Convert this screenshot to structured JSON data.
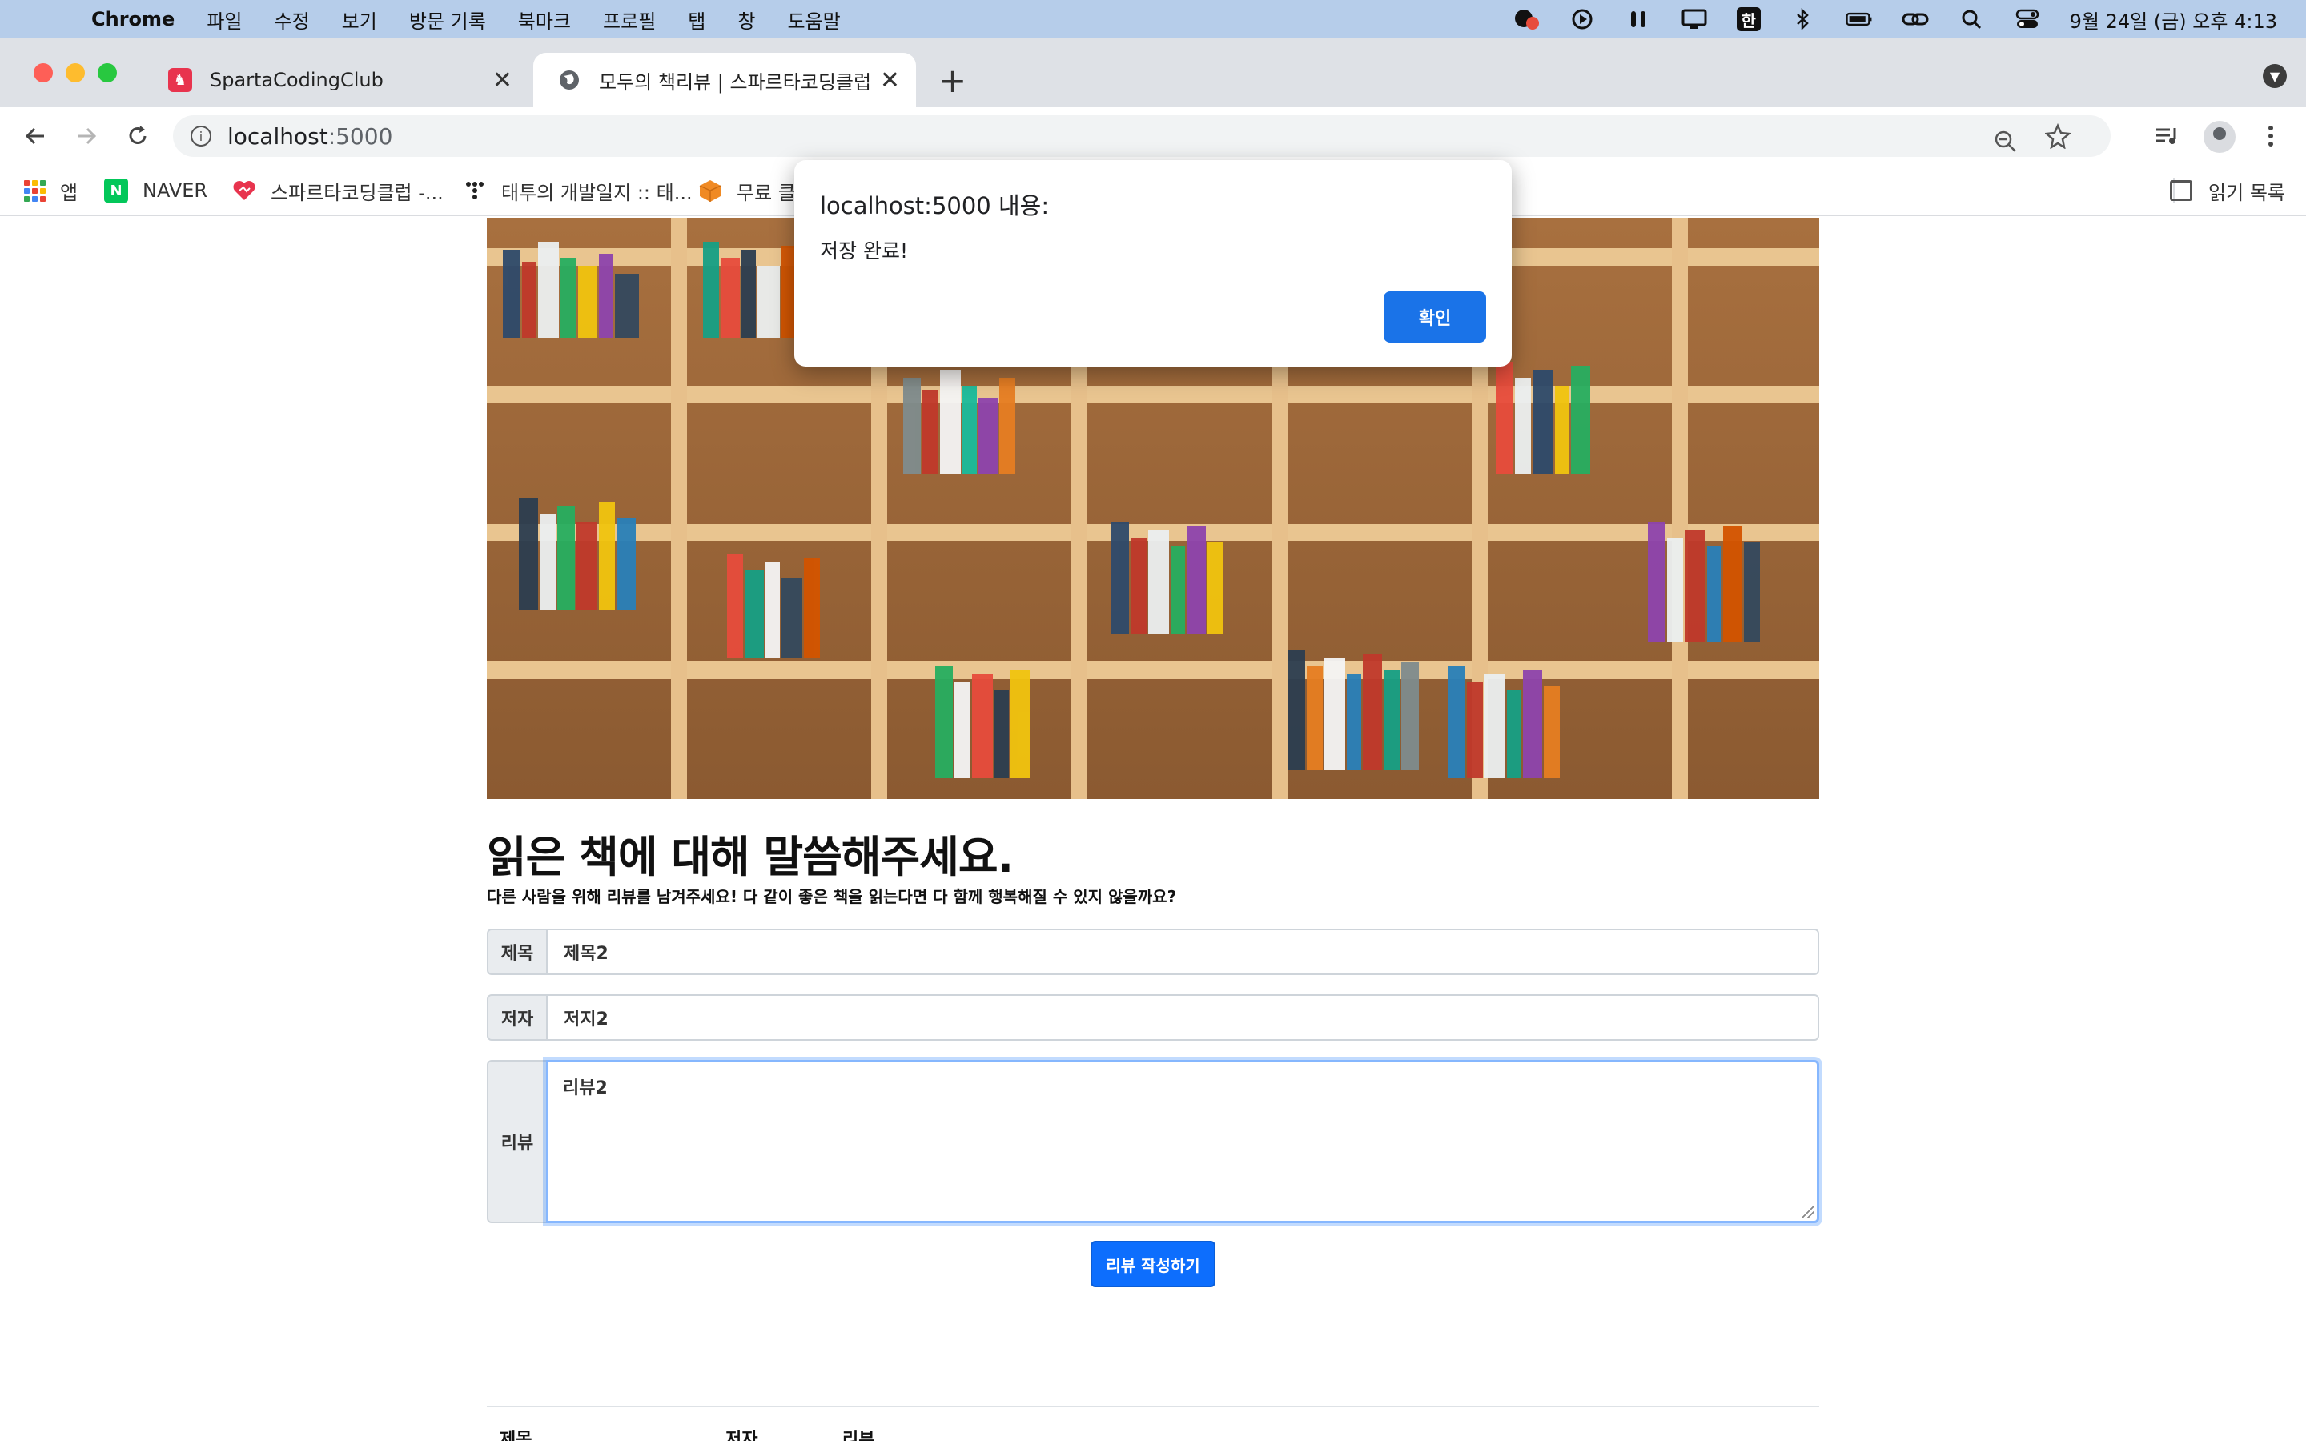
{
  "menubar": {
    "app_name": "Chrome",
    "items": [
      "파일",
      "수정",
      "보기",
      "방문 기록",
      "북마크",
      "프로필",
      "탭",
      "창",
      "도움말"
    ],
    "han_label": "한",
    "clock": "9월 24일 (금) 오후 4:13"
  },
  "tabs": [
    {
      "title": "SpartaCodingClub",
      "close": "✕"
    },
    {
      "title": "모두의 책리뷰 | 스파르타코딩클럽",
      "close": "✕"
    }
  ],
  "toolbar": {
    "url_host": "localhost",
    "url_port": ":5000"
  },
  "bookmarks": {
    "items": [
      "앱",
      "NAVER",
      "스파르타코딩클럽 -...",
      "태투의 개발일지 :: 태...",
      "무료 클"
    ],
    "naver_letter": "N",
    "reading_list": "읽기 목록"
  },
  "page": {
    "headline": "읽은 책에 대해 말씀해주세요.",
    "subline": "다른 사람을 위해 리뷰를 남겨주세요! 다 같이 좋은 책을 읽는다면 다 함께 행복해질 수 있지 않을까요?",
    "form": {
      "title_label": "제목",
      "title_value": "제목2",
      "author_label": "저자",
      "author_value": "저지2",
      "review_label": "리뷰",
      "review_value": "리뷰2",
      "submit_label": "리뷰 작성하기"
    },
    "table_headers": [
      "제목",
      "저자",
      "리뷰"
    ]
  },
  "dialog": {
    "title": "localhost:5000 내용:",
    "message": "저장 완료!",
    "ok_label": "확인"
  },
  "colors": {
    "menubar_bg": "#b6cdea",
    "accent_blue": "#1a73e8",
    "bootstrap_primary": "#0d6efd",
    "sparta_red": "#e8344e"
  }
}
